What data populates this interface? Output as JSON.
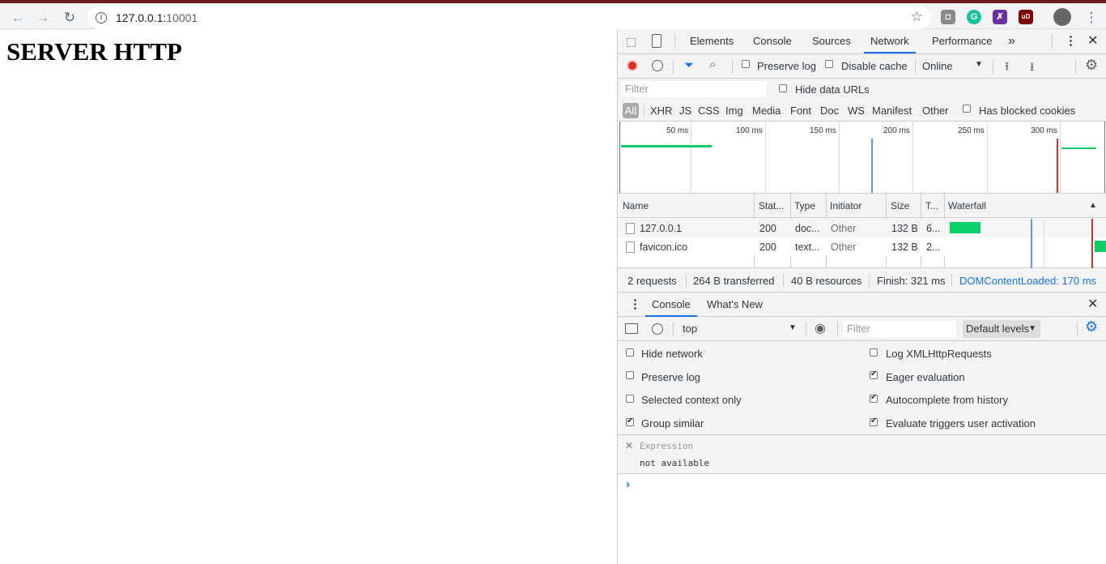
{
  "browser": {
    "url_host": "127.0.0.1:",
    "url_port": "10001",
    "info_icon": "i",
    "nav_icons": [
      "back-arrow-icon",
      "forward-arrow-icon",
      "reload-icon"
    ],
    "star_icon": "star-icon",
    "ext_labels": [
      "G",
      "✗",
      "uD"
    ],
    "menu_glyph": "⋮"
  },
  "page": {
    "heading": "SERVER HTTP"
  },
  "devtools": {
    "tabs": [
      "Elements",
      "Console",
      "Sources",
      "Network",
      "Performance"
    ],
    "active_tab": "Network",
    "more_tabs": "»",
    "network_toolbar": {
      "preserve_log": "Preserve log",
      "disable_cache": "Disable cache",
      "throttling": "Online"
    },
    "filter": {
      "placeholder": "Filter",
      "hide_data_urls": "Hide data URLs"
    },
    "type_filters": [
      "All",
      "XHR",
      "JS",
      "CSS",
      "Img",
      "Media",
      "Font",
      "Doc",
      "WS",
      "Manifest",
      "Other"
    ],
    "has_blocked_cookies": "Has blocked cookies",
    "timeline_labels": [
      "50 ms",
      "100 ms",
      "150 ms",
      "200 ms",
      "250 ms",
      "300 ms"
    ],
    "table": {
      "headers": [
        "Name",
        "Stat...",
        "Type",
        "Initiator",
        "Size",
        "T...",
        "Waterfall"
      ],
      "sort_glyph": "▲",
      "rows": [
        {
          "name": "127.0.0.1",
          "status": "200",
          "type": "doc...",
          "initiator": "Other",
          "size": "132 B",
          "time": "6..."
        },
        {
          "name": "favicon.ico",
          "status": "200",
          "type": "text...",
          "initiator": "Other",
          "size": "132 B",
          "time": "2..."
        }
      ]
    },
    "summary": {
      "requests": "2 requests",
      "transferred": "264 B transferred",
      "resources": "40 B resources",
      "finish": "Finish: 321 ms",
      "dom_content_loaded": "DOMContentLoaded: 170 ms"
    },
    "drawer": {
      "tabs": [
        "Console",
        "What's New"
      ],
      "context": "top",
      "filter_placeholder": "Filter",
      "levels": "Default levels",
      "settings_left": [
        "Hide network",
        "Preserve log",
        "Selected context only",
        "Group similar"
      ],
      "settings_left_checked": [
        false,
        false,
        false,
        true
      ],
      "settings_right": [
        "Log XMLHttpRequests",
        "Eager evaluation",
        "Autocomplete from history",
        "Evaluate triggers user activation"
      ],
      "settings_right_checked": [
        false,
        true,
        true,
        true
      ],
      "expression_placeholder": "Expression",
      "expression_value": "not available",
      "prompt": "›"
    }
  },
  "colors": {
    "accent": "#1a73e8",
    "record": "#d93025",
    "waterfall_green": "#0cce6b",
    "dcl_line": "#1a73e8",
    "load_line": "#e3342f"
  }
}
